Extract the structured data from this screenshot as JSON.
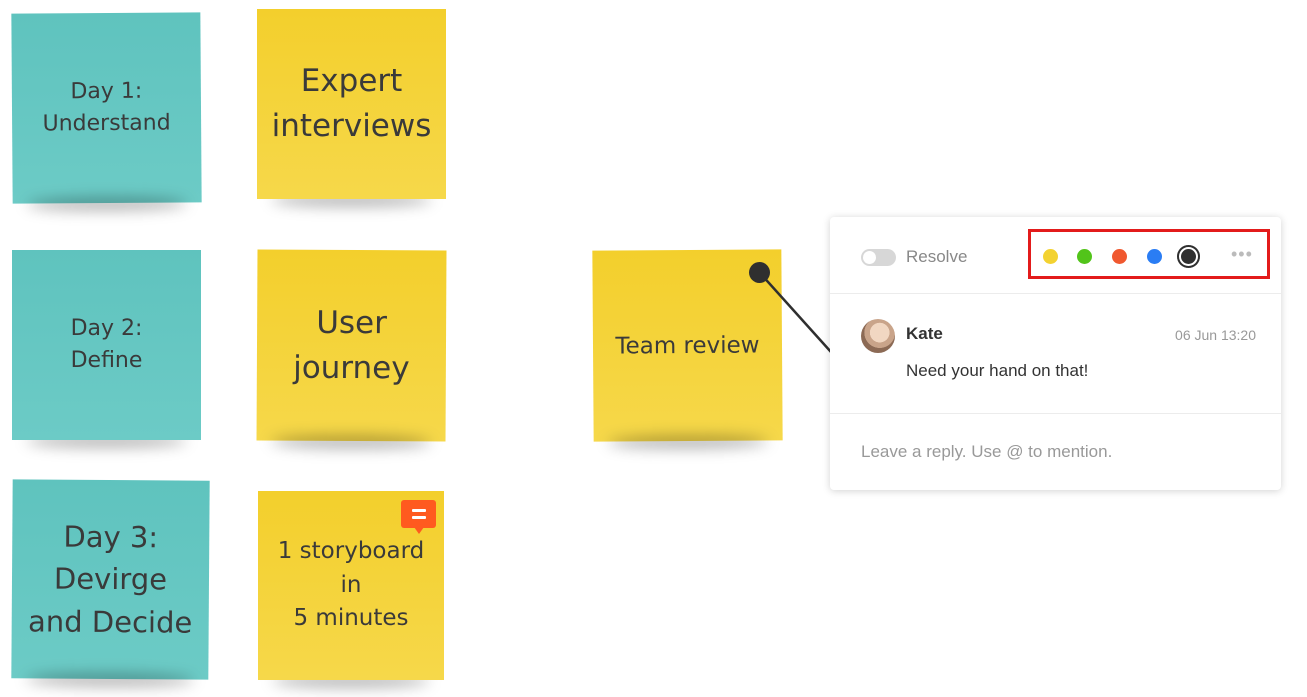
{
  "board": {
    "notes": [
      {
        "text": "Day 1:\nUnderstand",
        "color": "#5fc3be"
      },
      {
        "text": "Expert\ninterviews",
        "color": "#f3cf2c"
      },
      {
        "text": "Day 2:\nDefine",
        "color": "#5fc3be"
      },
      {
        "text": "User\njourney",
        "color": "#f3cf2c"
      },
      {
        "text": "Team review",
        "color": "#f3cf2c"
      },
      {
        "text": "Day 3:\nDevirge\nand Decide",
        "color": "#5fc3be"
      },
      {
        "text": "1 storyboard\nin\n5 minutes",
        "color": "#f3cf2c"
      }
    ],
    "comment_badge_icon": "comment-icon"
  },
  "comment_panel": {
    "resolve_label": "Resolve",
    "colors": [
      "#f3d231",
      "#52c41a",
      "#f0582f",
      "#2a7df4",
      "#2f2f2f"
    ],
    "selected_color": "#2f2f2f",
    "more_label": "•••",
    "message": {
      "author": "Kate",
      "timestamp": "06 Jun 13:20",
      "text": "Need your hand on that!"
    },
    "reply_placeholder": "Leave a reply. Use @ to mention."
  }
}
